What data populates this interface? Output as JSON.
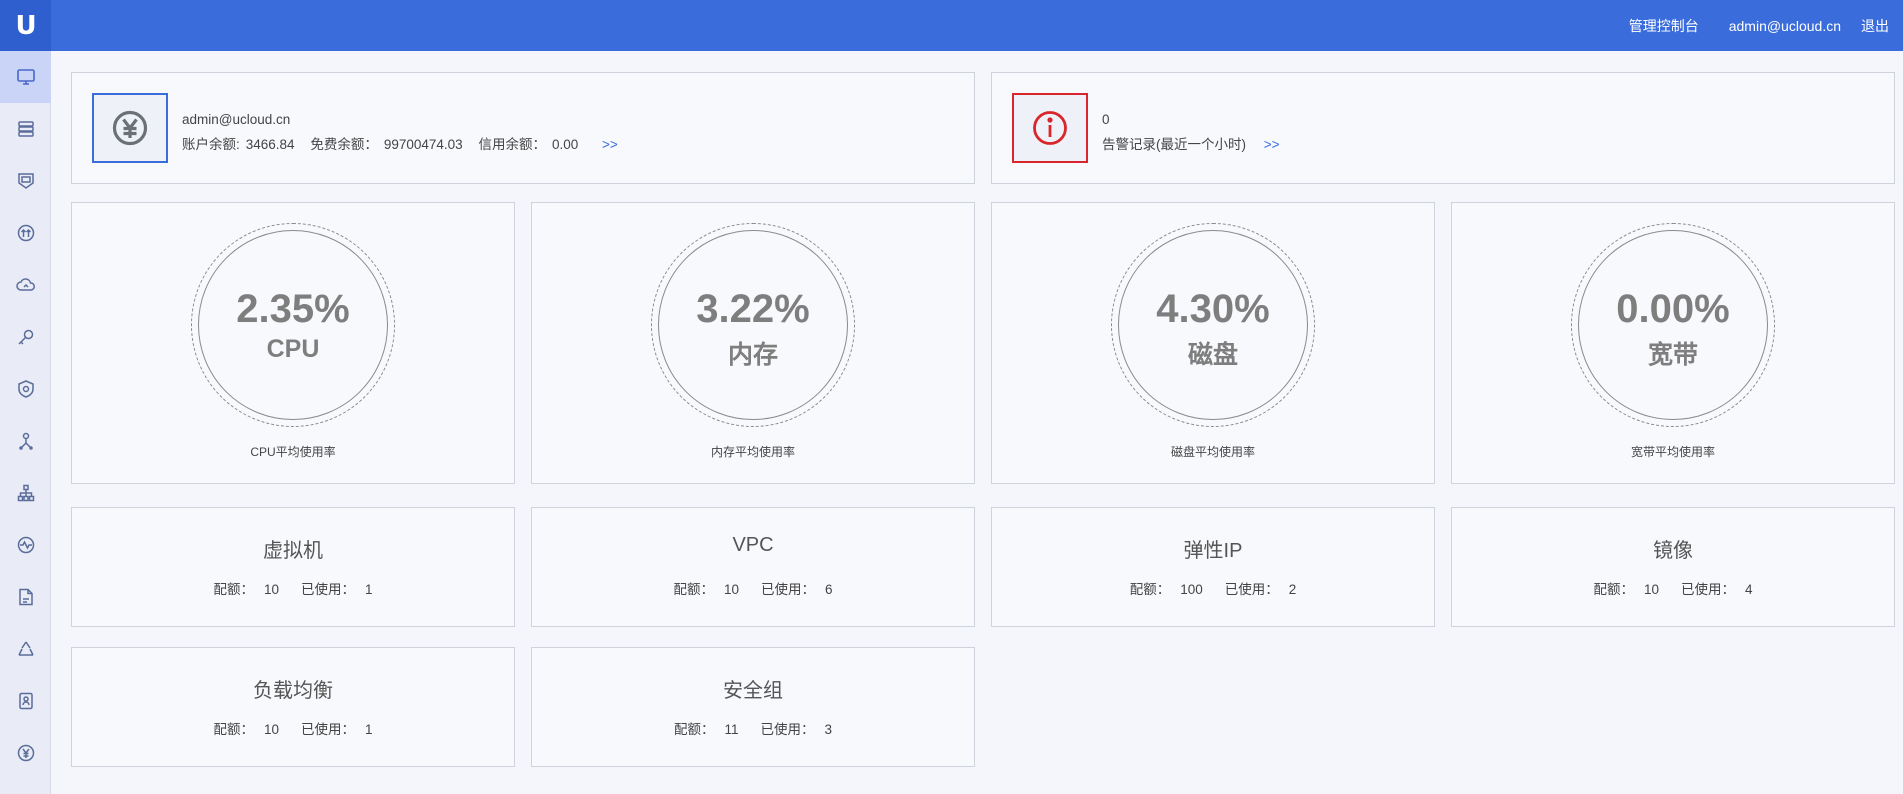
{
  "header": {
    "logo_text": "U",
    "nav": {
      "console": "管理控制台",
      "user": "admin@ucloud.cn",
      "logout": "退出"
    },
    "color": "#3a6cdc"
  },
  "sidebar": {
    "items": [
      {
        "icon": "monitor-icon",
        "active": true
      },
      {
        "icon": "storage-icon"
      },
      {
        "icon": "shield-image-icon"
      },
      {
        "icon": "network-icon"
      },
      {
        "icon": "cloud-icon"
      },
      {
        "icon": "key-icon"
      },
      {
        "icon": "security-shield-icon"
      },
      {
        "icon": "user-tree-icon"
      },
      {
        "icon": "topology-icon"
      },
      {
        "icon": "monitor-wave-icon"
      },
      {
        "icon": "document-icon"
      },
      {
        "icon": "recycle-icon"
      },
      {
        "icon": "contact-card-icon"
      },
      {
        "icon": "yuan-icon"
      }
    ]
  },
  "account": {
    "email": "admin@ucloud.cn",
    "balance_label": "账户余额:",
    "balance": "3466.84",
    "free_label": "免费余额：",
    "free": "99700474.03",
    "credit_label": "信用余额：",
    "credit": "0.00",
    "more": ">>"
  },
  "alarm": {
    "count": "0",
    "label": "告警记录(最近一个小时)",
    "more": ">>"
  },
  "gauges": [
    {
      "value": "2.35%",
      "name": "CPU",
      "caption": "CPU平均使用率"
    },
    {
      "value": "3.22%",
      "name": "内存",
      "caption": "内存平均使用率"
    },
    {
      "value": "4.30%",
      "name": "磁盘",
      "caption": "磁盘平均使用率"
    },
    {
      "value": "0.00%",
      "name": "宽带",
      "caption": "宽带平均使用率"
    }
  ],
  "quota_labels": {
    "quota": "配额：",
    "used": "已使用："
  },
  "quotas": [
    {
      "title": "虚拟机",
      "quota": "10",
      "used": "1"
    },
    {
      "title": "VPC",
      "quota": "10",
      "used": "6"
    },
    {
      "title": "弹性IP",
      "quota": "100",
      "used": "2"
    },
    {
      "title": "镜像",
      "quota": "10",
      "used": "4"
    },
    {
      "title": "负载均衡",
      "quota": "10",
      "used": "1"
    },
    {
      "title": "安全组",
      "quota": "11",
      "used": "3"
    }
  ]
}
